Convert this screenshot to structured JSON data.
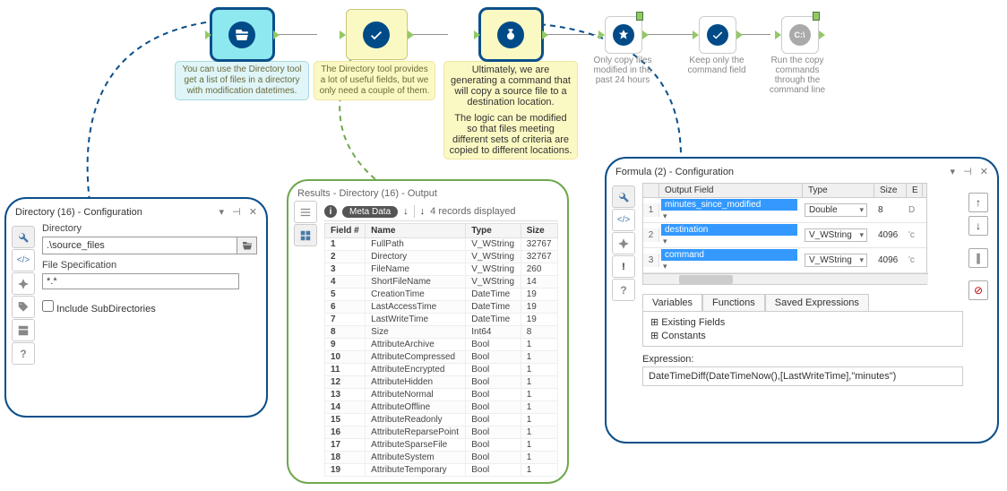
{
  "workflow": {
    "nodes": [
      {
        "id": "dir",
        "annotation": "You can use the Directory tool get a list of files in a directory with modification datetimes."
      },
      {
        "id": "sel1",
        "annotation": "The Directory tool provides a lot of useful fields, but we only need a couple of them."
      },
      {
        "id": "formula",
        "annotation_top": "Ultimately, we are generating a command that will copy a source file to a destination location.",
        "annotation_bottom": "The logic can be modified so that files meeting different sets of criteria are copied to different locations."
      },
      {
        "id": "filter",
        "label": "Only copy files modified in the past 24 hours"
      },
      {
        "id": "sel2",
        "label": "Keep only the command field"
      },
      {
        "id": "cmd",
        "label": "Run the copy commands through the command line"
      }
    ]
  },
  "directory_panel": {
    "title": "Directory (16) - Configuration",
    "labels": {
      "directory": "Directory",
      "file_spec": "File Specification",
      "include_sub": "Include SubDirectories"
    },
    "values": {
      "directory": ".\\source_files",
      "file_spec": "*.*",
      "include_sub": false
    }
  },
  "results_panel": {
    "title": "Results - Directory (16) - Output",
    "meta_label": "Meta Data",
    "records_text": "4 records displayed",
    "columns": [
      "Field #",
      "Name",
      "Type",
      "Size"
    ],
    "rows": [
      [
        "1",
        "FullPath",
        "V_WString",
        "32767"
      ],
      [
        "2",
        "Directory",
        "V_WString",
        "32767"
      ],
      [
        "3",
        "FileName",
        "V_WString",
        "260"
      ],
      [
        "4",
        "ShortFileName",
        "V_WString",
        "14"
      ],
      [
        "5",
        "CreationTime",
        "DateTime",
        "19"
      ],
      [
        "6",
        "LastAccessTime",
        "DateTime",
        "19"
      ],
      [
        "7",
        "LastWriteTime",
        "DateTime",
        "19"
      ],
      [
        "8",
        "Size",
        "Int64",
        "8"
      ],
      [
        "9",
        "AttributeArchive",
        "Bool",
        "1"
      ],
      [
        "10",
        "AttributeCompressed",
        "Bool",
        "1"
      ],
      [
        "11",
        "AttributeEncrypted",
        "Bool",
        "1"
      ],
      [
        "12",
        "AttributeHidden",
        "Bool",
        "1"
      ],
      [
        "13",
        "AttributeNormal",
        "Bool",
        "1"
      ],
      [
        "14",
        "AttributeOffline",
        "Bool",
        "1"
      ],
      [
        "15",
        "AttributeReadonly",
        "Bool",
        "1"
      ],
      [
        "16",
        "AttributeReparsePoint",
        "Bool",
        "1"
      ],
      [
        "17",
        "AttributeSparseFile",
        "Bool",
        "1"
      ],
      [
        "18",
        "AttributeSystem",
        "Bool",
        "1"
      ],
      [
        "19",
        "AttributeTemporary",
        "Bool",
        "1"
      ]
    ]
  },
  "formula_panel": {
    "title": "Formula (2) - Configuration",
    "grid_headers": {
      "output": "Output Field",
      "type": "Type",
      "size": "Size",
      "e": "E"
    },
    "rows": [
      {
        "num": "1",
        "field": "minutes_since_modified",
        "type": "Double",
        "size": "8",
        "e": "D"
      },
      {
        "num": "2",
        "field": "destination",
        "type": "V_WString",
        "size": "4096",
        "e": "'c"
      },
      {
        "num": "3",
        "field": "command",
        "type": "V_WString",
        "size": "4096",
        "e": "'c"
      }
    ],
    "tabs": [
      "Variables",
      "Functions",
      "Saved Expressions"
    ],
    "tree": [
      "Existing Fields",
      "Constants"
    ],
    "expression_label": "Expression:",
    "expression": "DateTimeDiff(DateTimeNow(),[LastWriteTime],\"minutes\")"
  }
}
